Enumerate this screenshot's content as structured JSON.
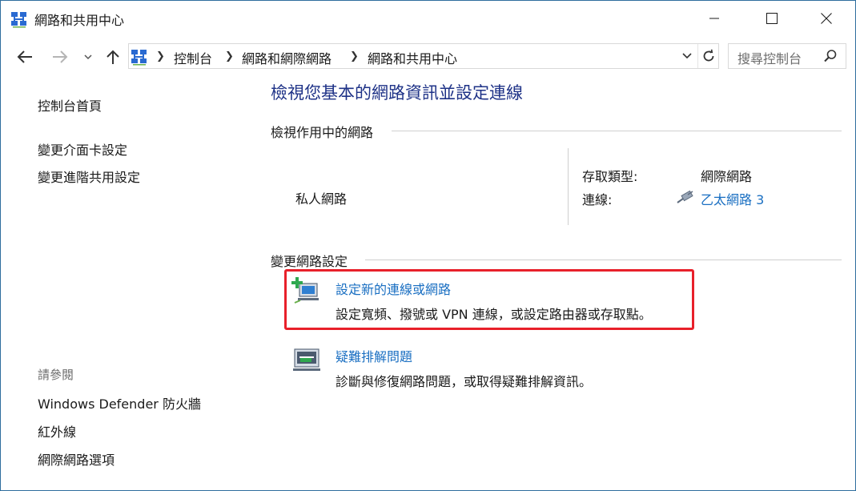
{
  "window": {
    "title": "網路和共用中心",
    "icon": "network-center-icon"
  },
  "toolbar": {
    "back_icon": "arrow-left-icon",
    "forward_icon": "arrow-right-icon",
    "recent_icon": "chevron-down-icon",
    "up_icon": "arrow-up-icon",
    "refresh_icon": "refresh-icon"
  },
  "address": {
    "crumbs": [
      "控制台",
      "網路和網際網路",
      "網路和共用中心"
    ]
  },
  "search": {
    "placeholder": "搜尋控制台"
  },
  "sidebar": {
    "home": "控制台首頁",
    "links": [
      "變更介面卡設定",
      "變更進階共用設定"
    ],
    "see_also_label": "請參閱",
    "see_also": [
      "Windows Defender 防火牆",
      "紅外線",
      "網際網路選項"
    ]
  },
  "main": {
    "title": "檢視您基本的網路資訊並設定連線",
    "active_heading": "檢視作用中的網路",
    "network_name": "私人網路",
    "access_type_label": "存取類型:",
    "access_type_value": "網際網路",
    "connections_label": "連線:",
    "connections_value": "乙太網路 3",
    "change_heading": "變更網路設定",
    "tasks": [
      {
        "title": "設定新的連線或網路",
        "description": "設定寬頻、撥號或 VPN 連線，或設定路由器或存取點。",
        "icon": "new-connection-icon"
      },
      {
        "title": "疑難排解問題",
        "description": "診斷與修復網路問題，或取得疑難排解資訊。",
        "icon": "troubleshoot-icon"
      }
    ]
  },
  "colors": {
    "accent_title": "#1e3287",
    "link": "#1a6fc2",
    "highlight": "#e8202a"
  }
}
